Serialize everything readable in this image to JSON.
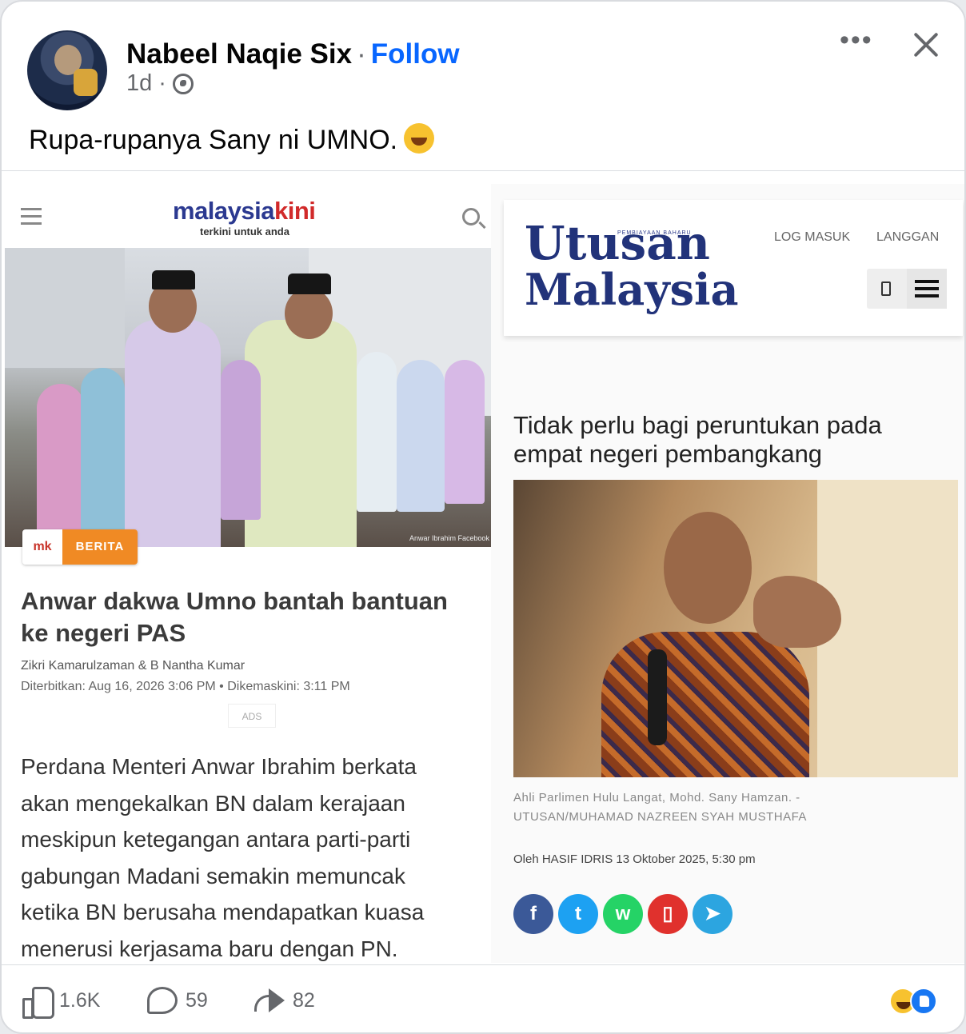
{
  "post": {
    "author": "Nabeel Naqie Six",
    "separator": "·",
    "follow_label": "Follow",
    "time": "1d",
    "time_sep": "·",
    "caption": "Rupa-rupanya Sany ni UMNO.",
    "more_label": "•••"
  },
  "left_article": {
    "logo_main": "malaysia",
    "logo_accent": "kini",
    "tagline": "terkini untuk anda",
    "badge_brand": "mk",
    "category": "BERITA",
    "photo_credit": "Anwar Ibrahim Facebook",
    "headline": "Anwar dakwa Umno bantah bantuan ke negeri PAS",
    "authors": "Zikri Kamarulzaman & B Nantha Kumar",
    "dates": "Diterbitkan: Aug 16, 2026 3:06 PM  •  Dikemaskini: 3:11 PM",
    "ads": "ADS",
    "body": "Perdana Menteri Anwar Ibrahim berkata akan mengekalkan BN dalam kerajaan meskipun ketegangan antara parti-parti gabungan Madani semakin memuncak ketika BN berusaha mendapatkan kuasa menerusi kerjasama baru dengan PN."
  },
  "right_article": {
    "small_label": "PEMBIAYAAN BAHARU",
    "logo_line1": "Utusan",
    "logo_line2": "Malaysia",
    "login_label": "LOG MASUK",
    "subscribe_label": "LANGGAN",
    "headline": "Tidak perlu bagi peruntukan pada empat negeri pembangkang",
    "caption_line1": "Ahli Parlimen Hulu Langat, Mohd. Sany Hamzan. -",
    "caption_line2": "UTUSAN/MUHAMAD NAZREEN SYAH MUSTHAFA",
    "byline": "Oleh  HASIF IDRIS   13 Oktober 2025, 5:30 pm",
    "share": [
      {
        "icon": "facebook-icon",
        "glyph": "f",
        "color": "#3b5998"
      },
      {
        "icon": "twitter-icon",
        "glyph": "t",
        "color": "#1da1f2"
      },
      {
        "icon": "whatsapp-icon",
        "glyph": "w",
        "color": "#25d366"
      },
      {
        "icon": "mobile-share-icon",
        "glyph": "▯",
        "color": "#e0312d"
      },
      {
        "icon": "telegram-icon",
        "glyph": "➤",
        "color": "#2ca5e0"
      }
    ]
  },
  "footer": {
    "likes": "1.6K",
    "comments": "59",
    "shares": "82"
  }
}
